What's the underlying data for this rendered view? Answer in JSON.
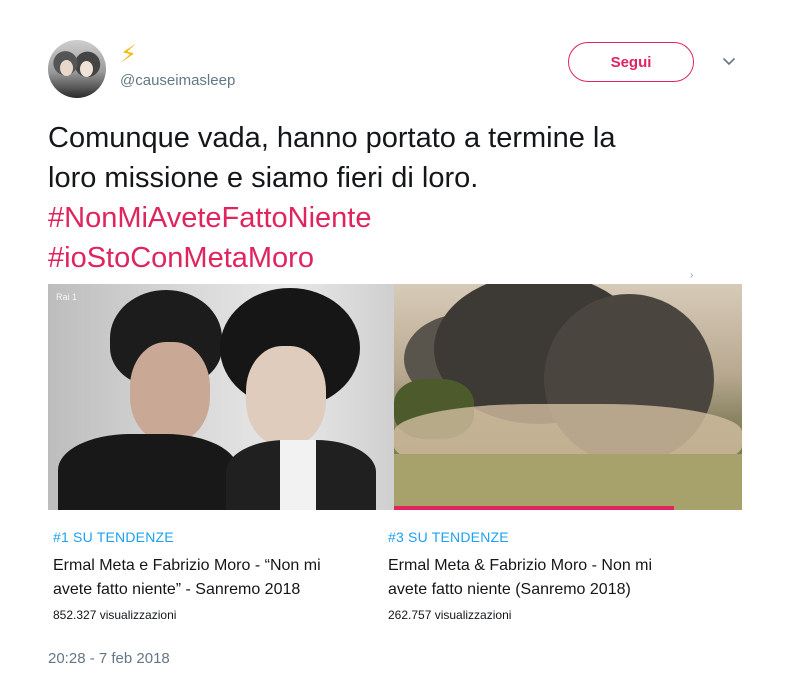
{
  "header": {
    "display_name": "⚡",
    "handle": "@causeimasleep",
    "follow_label": "Segui",
    "caret_icon": "chevron-down-icon"
  },
  "tweet": {
    "text_line1": "Comunque vada, hanno portato a termine la",
    "text_line2": "loro missione e siamo fieri di loro.",
    "hashtag1": "#NonMiAveteFattoNiente",
    "hashtag2": "#ioStoConMetaMoro",
    "timestamp": "20:28 - 7 feb 2018"
  },
  "cards": [
    {
      "rank": "#1 SU TENDENZE",
      "title": "Ermal Meta e Fabrizio Moro - “Non mi avete fatto niente” - Sanremo 2018",
      "views": "852.327 visualizzazioni",
      "thumb_logo": "Rai 1"
    },
    {
      "rank": "#3 SU TENDENZE",
      "title": "Ermal Meta & Fabrizio Moro - Non mi avete fatto niente (Sanremo 2018)",
      "views": "262.757 visualizzazioni"
    }
  ],
  "colors": {
    "accent": "#e0245e",
    "link": "#1da1f2",
    "muted": "#657786"
  }
}
